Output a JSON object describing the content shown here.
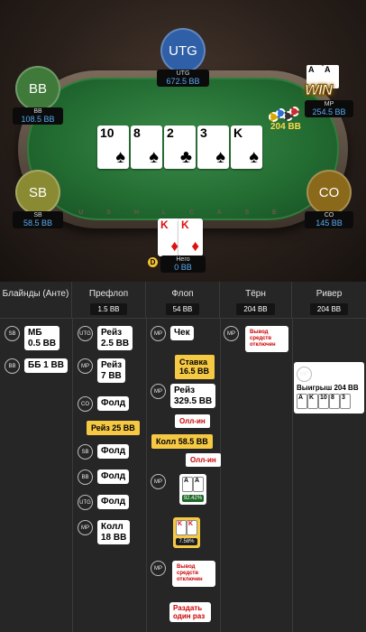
{
  "table": {
    "felt_text": "U S H L C A S E",
    "seats": {
      "utg": {
        "avatar": "UTG",
        "name": "UTG",
        "stack": "672.5 BB",
        "color": "#2f5fa6"
      },
      "bb": {
        "avatar": "BB",
        "name": "BB",
        "stack": "108.5 BB",
        "color": "#3f7a3a"
      },
      "mp": {
        "name": "MP",
        "stack": "254.5 BB"
      },
      "sb": {
        "avatar": "SB",
        "name": "SB",
        "stack": "58.5 BB",
        "color": "#8a8a33"
      },
      "co": {
        "avatar": "CO",
        "name": "CO",
        "stack": "145 BB",
        "color": "#8a6a1a"
      },
      "hero": {
        "name": "Него",
        "stack": "0 BB"
      }
    },
    "board": [
      {
        "rank": "10",
        "suit": "♠",
        "color": "black"
      },
      {
        "rank": "8",
        "suit": "♠",
        "color": "black"
      },
      {
        "rank": "2",
        "suit": "♣",
        "color": "black"
      },
      {
        "rank": "3",
        "suit": "♠",
        "color": "black"
      },
      {
        "rank": "K",
        "suit": "♠",
        "color": "black"
      }
    ],
    "hero_cards": [
      {
        "rank": "K",
        "suit": "♦",
        "color": "red"
      },
      {
        "rank": "K",
        "suit": "♦",
        "color": "red"
      }
    ],
    "pot": "204 BB",
    "dealer": "D",
    "win_badge": {
      "text": "WIN",
      "cards": [
        "A",
        "A"
      ]
    }
  },
  "history": {
    "streets": [
      {
        "name": "Блайнды (Анте)",
        "pot": ""
      },
      {
        "name": "Префлоп",
        "pot": "1.5 BB"
      },
      {
        "name": "Флоп",
        "pot": "54 BB"
      },
      {
        "name": "Тёрн",
        "pot": "204 BB"
      },
      {
        "name": "Ривер",
        "pot": "204 BB"
      }
    ],
    "blinds": [
      {
        "pos": "SB",
        "text1": "МБ",
        "text2": "0.5 BB"
      },
      {
        "pos": "BB",
        "text1": "ББ 1 BB",
        "text2": ""
      }
    ],
    "preflop": [
      {
        "pos": "UTG",
        "text1": "Рейз",
        "text2": "2.5 BB"
      },
      {
        "pos": "MP",
        "text1": "Рейз",
        "text2": "7 BB"
      },
      {
        "pos": "CO",
        "text1": "Фолд",
        "text2": ""
      },
      {
        "pos": "SB",
        "text1": "Фолд",
        "text2": ""
      },
      {
        "pos": "BB",
        "text1": "Фолд",
        "text2": ""
      },
      {
        "pos": "UTG",
        "text1": "Фолд",
        "text2": ""
      },
      {
        "pos": "MP",
        "text1": "Колл",
        "text2": "18 BB"
      }
    ],
    "hero_raise": "Рейз 25 BB",
    "flop": {
      "check": {
        "pos": "MP",
        "text": "Чек"
      },
      "bet": "Ставка 16.5 BB",
      "raise": {
        "pos": "MP",
        "text1": "Рейз",
        "text2": "329.5 BB"
      },
      "allin": "Олл-ин",
      "call": "Колл 58.5 BB",
      "allin2": "Олл-ин",
      "villain_cards": {
        "pos": "MP",
        "cards": [
          "A",
          "A"
        ],
        "equity": "92.42%"
      },
      "hero_cards": {
        "cards": [
          "K",
          "K"
        ],
        "equity": "7.58%"
      },
      "deal": {
        "pos": "MP",
        "text": "Вывод средств отключен"
      },
      "deal_once": "Раздать один раз"
    },
    "turn": {
      "pos": "MP",
      "text": "Вывод средств отключен"
    },
    "river": {
      "pos": "MP",
      "win": "Выигрыш 204 BB",
      "cards": [
        "A",
        "K",
        "10",
        "8",
        "3"
      ]
    }
  }
}
